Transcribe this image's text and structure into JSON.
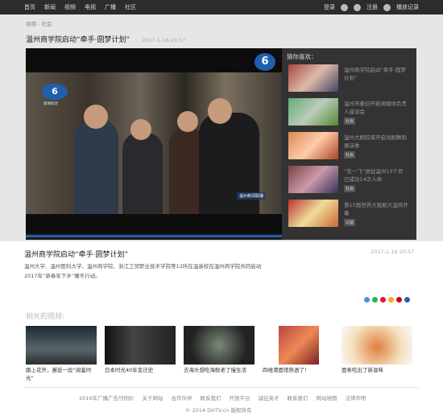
{
  "topbar": {
    "nav": [
      "首页",
      "新闻",
      "视频",
      "电视",
      "广播",
      "社区"
    ],
    "login": "登录",
    "register": "注册",
    "history": "播放记录"
  },
  "breadcrumb": "视频 - 社会",
  "video": {
    "title": "温州商学院启动“牵手·圆梦计划”",
    "date": "2017-1-16 20:57",
    "logo_char": "6",
    "station_tag": "温州新闻联播",
    "channel_label": "新闻综合"
  },
  "sidebar": {
    "heading": "猜你喜欢：",
    "items": [
      {
        "text": "温州商学院启动“牵手·圆梦计划”",
        "badge": ""
      },
      {
        "text": "温州市委召开新闻媒体负责人座谈会",
        "badge": "社会"
      },
      {
        "text": "温州大剧院将开启戏剧舞蹈展演季",
        "badge": "社会"
      },
      {
        "text": "“东一飞”进驻温州13个月 已成功14次人命",
        "badge": "社会"
      },
      {
        "text": "第15届世界大瓯剧大温商开幕",
        "badge": "公益"
      }
    ]
  },
  "below": {
    "title": "温州商学院启动“牵手·圆梦计划”",
    "date": "2017-1-16 20:57",
    "desc_line1": "温州大学、温州医科大学、温州商学院、浙江工贸职业技术学院等12所在温高校在温州商学院共同启动",
    "desc_line2": "2017年“新春年下乡”暖冬行动。"
  },
  "related": {
    "heading": "相关的视频:",
    "items": [
      {
        "caption": "路上花开，邂逅一段“阅鉴时光”"
      },
      {
        "caption": "日本时光40年变迁史"
      },
      {
        "caption": "去海头想吃海鲜老了慢生活"
      },
      {
        "caption": "四维港面馆熟透了！"
      },
      {
        "caption": "面条吃出了新滋味"
      }
    ]
  },
  "footer": {
    "links": [
      "2016年广播广告刊例价",
      "关于网站",
      "合作伙伴",
      "联系我们",
      "开放平台",
      "诚征英才",
      "联系我们",
      "网站地图",
      "法律声明"
    ],
    "copyright": "© 2014 DHTV.cn 版权所有"
  },
  "colors": {
    "accent": "#1f5fae",
    "topbar": "#2c2c2c"
  }
}
